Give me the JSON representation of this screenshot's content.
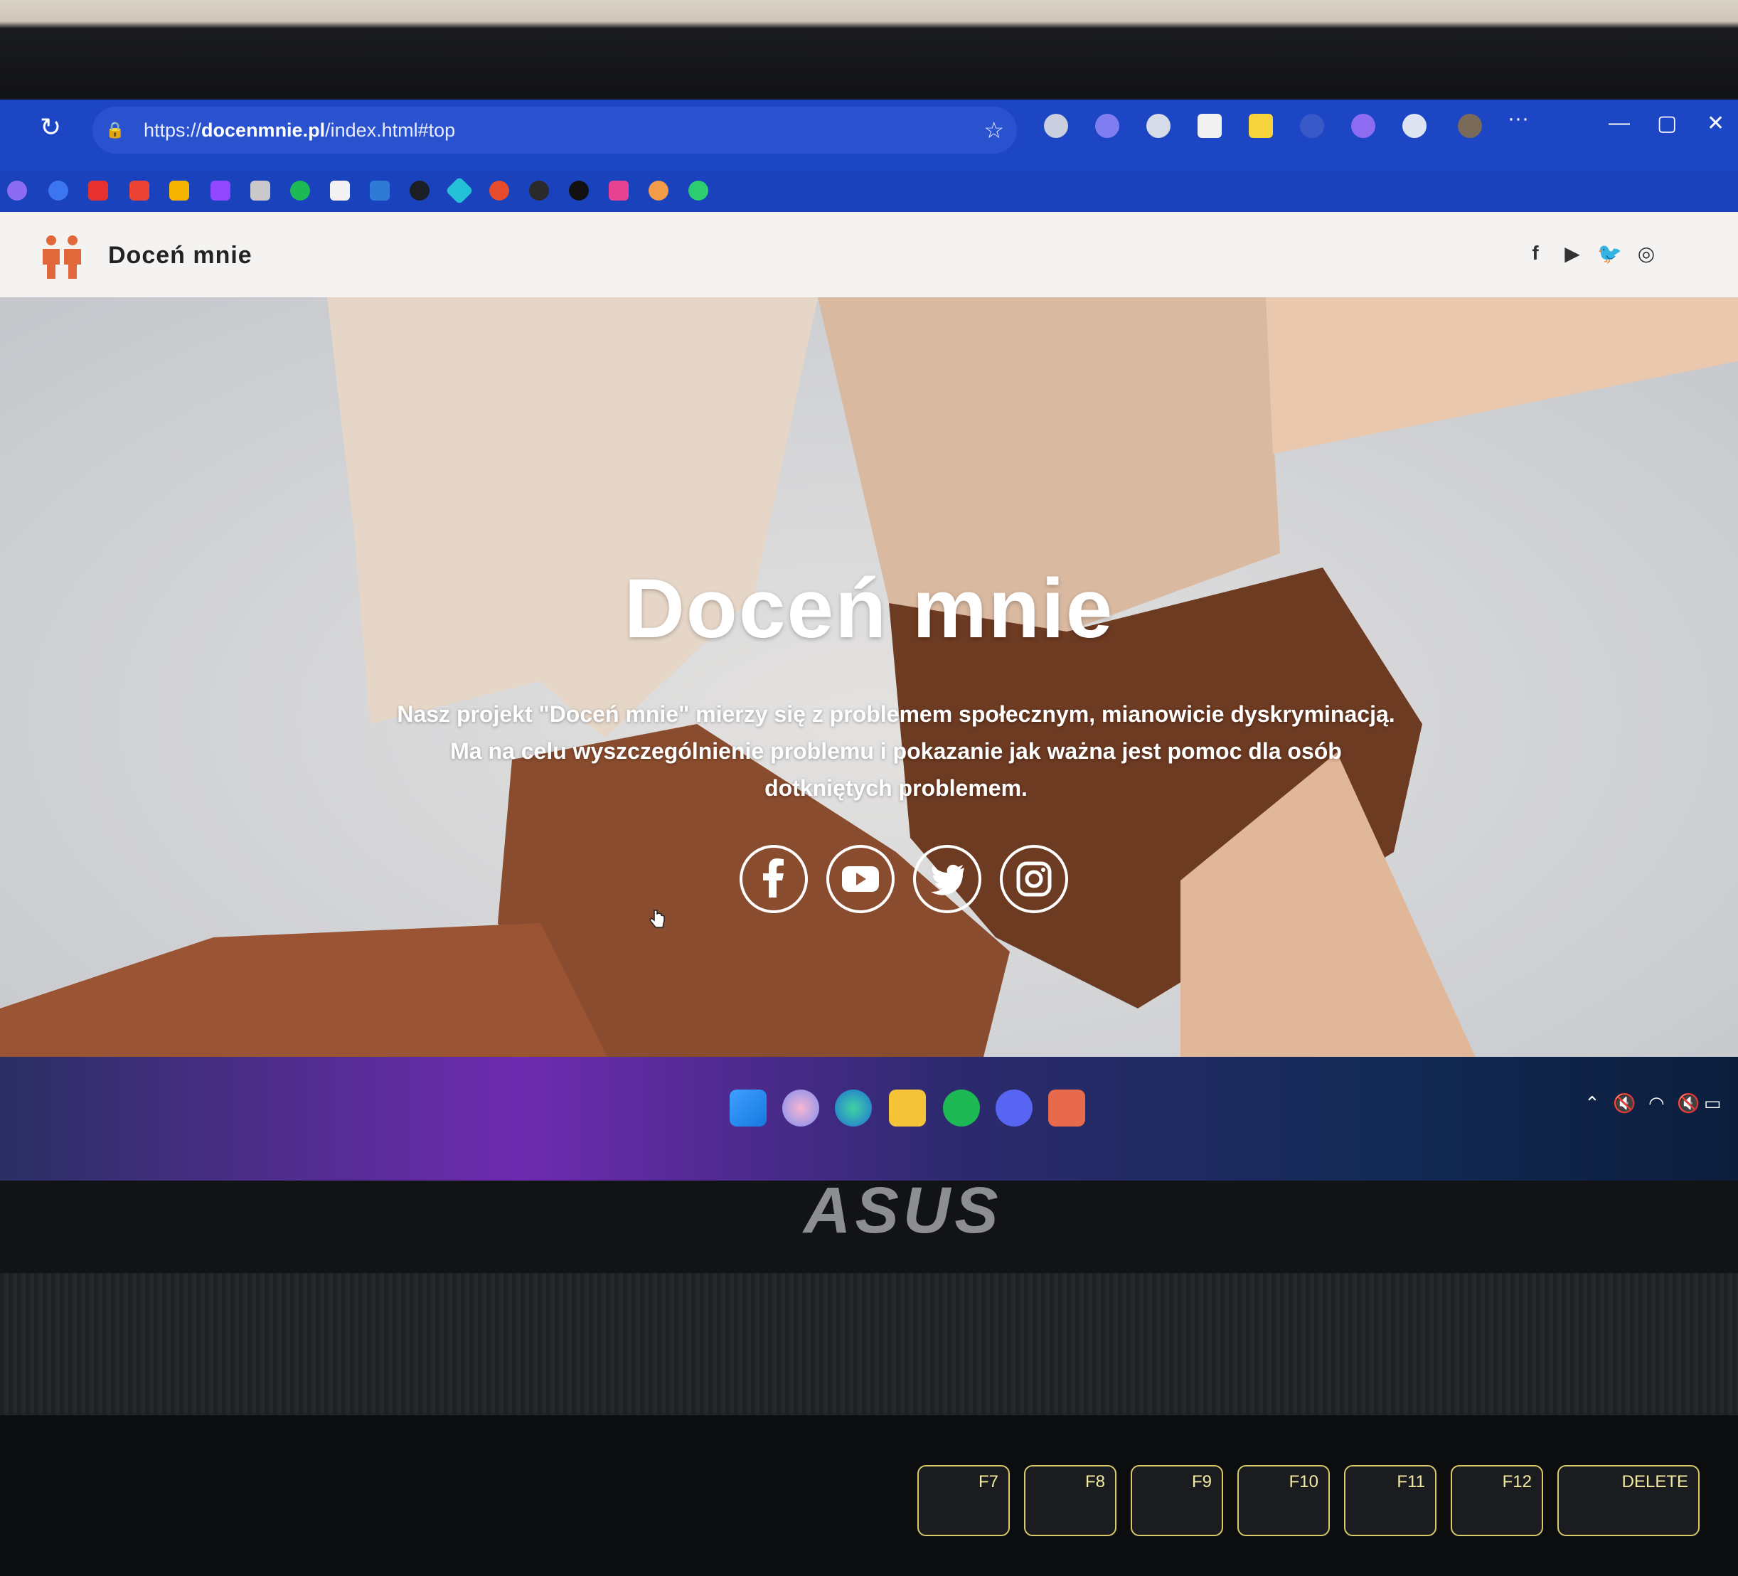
{
  "browser": {
    "url_prefix": "https://",
    "url_domain": "docenmnie.pl",
    "url_path": "/index.html#top",
    "more_label": "···"
  },
  "site": {
    "brand": "Doceń mnie",
    "hero": {
      "title": "Doceń mnie",
      "text": "Nasz projekt \"Doceń mnie\" mierzy się z problemem społecznym, mianowicie dyskryminacją. Ma na celu wyszczególnienie problemu i pokazanie jak ważna jest pomoc dla osób dotkniętych problemem."
    },
    "social": [
      "facebook",
      "youtube",
      "twitter",
      "instagram"
    ]
  },
  "colors": {
    "browser_chrome": "#1d46c4",
    "accent": "#e0683a",
    "hero_text": "#ffffff"
  },
  "laptop": {
    "brand": "ASUS",
    "keys": [
      "F7",
      "F8",
      "F9",
      "F10",
      "F11",
      "F12",
      "DELETE"
    ]
  }
}
